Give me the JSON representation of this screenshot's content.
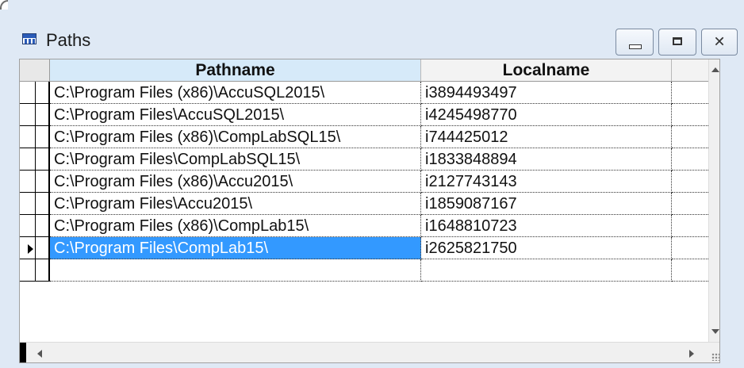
{
  "window": {
    "title": "Paths",
    "icon": "table-icon",
    "buttons": [
      {
        "name": "minimize-button",
        "icon": "minimize-icon"
      },
      {
        "name": "maximize-button",
        "icon": "maximize-icon"
      },
      {
        "name": "close-button",
        "icon": "close-icon",
        "glyph": "✕"
      }
    ]
  },
  "grid": {
    "columns": [
      "Pathname",
      "Localname"
    ],
    "rows": [
      {
        "pathname": "C:\\Program Files (x86)\\AccuSQL2015\\",
        "localname": "i3894493497"
      },
      {
        "pathname": "C:\\Program Files\\AccuSQL2015\\",
        "localname": "i4245498770"
      },
      {
        "pathname": "C:\\Program Files (x86)\\CompLabSQL15\\",
        "localname": "i744425012"
      },
      {
        "pathname": "C:\\Program Files\\CompLabSQL15\\",
        "localname": "i1833848894"
      },
      {
        "pathname": "C:\\Program Files (x86)\\Accu2015\\",
        "localname": "i2127743143"
      },
      {
        "pathname": "C:\\Program Files\\Accu2015\\",
        "localname": "i1859087167"
      },
      {
        "pathname": "C:\\Program Files (x86)\\CompLab15\\",
        "localname": "i1648810723"
      },
      {
        "pathname": "C:\\Program Files\\CompLab15\\",
        "localname": "i2625821750"
      },
      {
        "pathname": "",
        "localname": ""
      }
    ],
    "selected_row": 7
  },
  "colors": {
    "selection": "#3399ff",
    "header_active": "#d6eaf9",
    "frame": "#dfe9f5"
  }
}
